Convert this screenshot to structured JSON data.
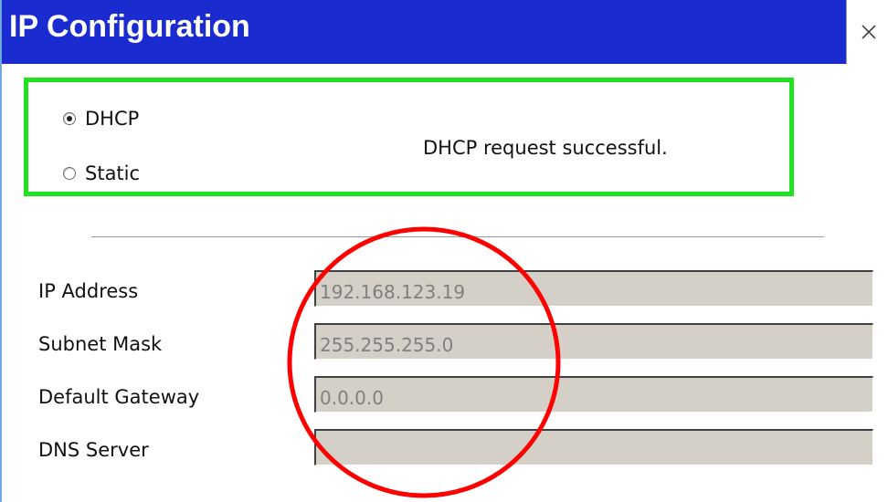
{
  "window": {
    "title": "IP Configuration"
  },
  "mode": {
    "options": [
      {
        "label": "DHCP",
        "checked": true
      },
      {
        "label": "Static",
        "checked": false
      }
    ],
    "status": "DHCP request successful."
  },
  "fields": [
    {
      "label": "IP Address",
      "value": "192.168.123.19"
    },
    {
      "label": "Subnet Mask",
      "value": "255.255.255.0"
    },
    {
      "label": "Default Gateway",
      "value": "0.0.0.0"
    },
    {
      "label": "DNS Server",
      "value": ""
    }
  ],
  "colors": {
    "titlebar": "#1a2bd0",
    "highlight_box": "#1fe31f",
    "annotation_circle": "#ff0000",
    "input_background": "#d4d0c8"
  },
  "icons": {
    "close": "close-icon"
  }
}
